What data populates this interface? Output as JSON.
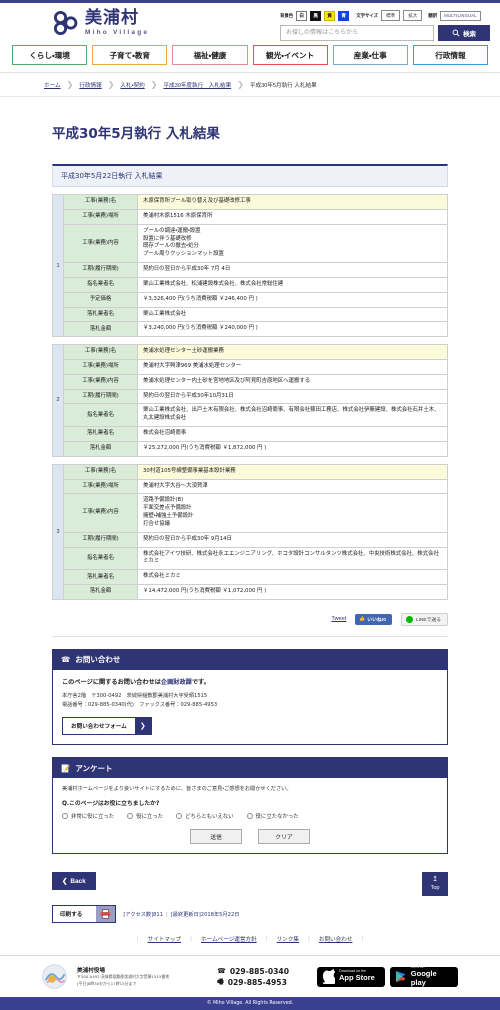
{
  "site": {
    "logo_jp": "美浦村",
    "logo_en": "Miho Village",
    "brand_color": "#2f3475"
  },
  "utility": {
    "bg_label": "背景色",
    "swatches": [
      {
        "name": "white",
        "label": "白"
      },
      {
        "name": "black",
        "label": "黒"
      },
      {
        "name": "yellow",
        "label": "黄"
      },
      {
        "name": "blue",
        "label": "青"
      }
    ],
    "fontsize_label": "文字サイズ",
    "fontsize_options": [
      "標準",
      "拡大"
    ],
    "translate_label": "翻訳",
    "multilingual": "MULTILINGUAL"
  },
  "search": {
    "placeholder": "お探しの情報はこちらから",
    "value": "",
    "button": "検索"
  },
  "gnav": [
    {
      "label": "くらし・環境",
      "color": "#57ab6a"
    },
    {
      "label": "子育て・教育",
      "color": "#e8a93a"
    },
    {
      "label": "福祉・健康",
      "color": "#e08d96"
    },
    {
      "label": "観光・イベント",
      "color": "#e8504a"
    },
    {
      "label": "産業・仕事",
      "color": "#7fa8c4"
    },
    {
      "label": "行政情報",
      "color": "#3e9ad6"
    }
  ],
  "breadcrumb": {
    "links": [
      "ホーム",
      "行政情報",
      "入札・契約",
      "平成30年度執行　入札結果"
    ],
    "current": "平成30年5月執行 入札結果"
  },
  "page": {
    "title": "平成30年5月執行 入札結果",
    "section_bar": "平成30年5月22日執行 入札結果"
  },
  "labels": {
    "name": "工事(業務)名",
    "place": "工事(業務)場所",
    "detail": "工事(業務)内容",
    "period": "工期(履行期間)",
    "nominated": "指名業者名",
    "planned_price": "予定価格",
    "winner": "落札業者名",
    "bid_amount": "落札金額"
  },
  "bids": [
    {
      "index": "1",
      "name": "木原保育所プール取り替え及び基礎改修工事",
      "place": "美浦村木原1516 木原保育所",
      "detail": "プールの調達・運搬・設置\n設置に伴う基礎改修\n既存プールの撤去・処分\nプール周りクッションマット設置",
      "period": "契約日の翌日から平成30年 7月 4日",
      "nominated": "栗山工業株式会社、松浦建設株式会社、株式会社常総住建",
      "planned_price": "￥3,326,400 円(うち消費税額 ￥246,400 円 )",
      "winner": "栗山工業株式会社",
      "bid_amount": "￥3,240,000 円(うち消費税額 ￥240,000 円 )"
    },
    {
      "index": "2",
      "name": "美浦水処理センター土砂運搬業務",
      "place": "美浦村大字興津969 美浦水処理センター",
      "detail": "美浦水処理センター内土砂を宮地地区及び阿見町吉原地区へ運搬する",
      "period": "契約日の翌日から平成30年10月31日",
      "nominated": "栗山工業株式会社、出戸土木有限会社、株式会社沼崎商事、有限会社篠田工務店、株式会社伊藤建設、株式会社石井土木、丸太建設株式会社",
      "winner": "株式会社沼崎商事",
      "bid_amount": "￥25,272,000 円(うち消費税額 ￥1,872,000 円 )"
    },
    {
      "index": "3",
      "name": "30村道105号線整備事業基本設計業務",
      "place": "美浦村大字大谷～大須賀津",
      "detail": "道路予備設計(B)\n平面交差点予備設計\n擁壁・補強土予備設計\n打合せ協議",
      "period": "契約日の翌日から平成30年 9月14日",
      "nominated": "株式会社アイワ技研、株式会社永エエンジニアリング、ホコタ設計コンサルタンツ株式会社、中央技術株式会社、株式会社ミカミ",
      "winner": "株式会社ミカミ",
      "bid_amount": "￥14,472,000 円(うち消費税額 ￥1,072,000 円 )"
    }
  ],
  "share": {
    "tweet": "Tweet",
    "facebook": "いいね!0",
    "line": "LINEで送る"
  },
  "inquiry": {
    "heading": "お問い合わせ",
    "lead_before": "このページに関するお問い合わせは",
    "lead_dept": "企画財政課",
    "lead_after": "です。",
    "address": "本庁舎2階　〒300-0492　茨城県稲敷郡美浦村大字受領1515",
    "contact": "電話番号：029-885-0340(代)　ファックス番号：029-885-4953",
    "form_button": "お問い合わせフォーム"
  },
  "enquete": {
    "heading": "アンケート",
    "lead": "美浦村ホームページをより良いサイトにするために、皆さまのご意見・ご感想をお聞かせください。",
    "question": "Q.このページはお役に立ちましたか?",
    "options": [
      "非常に役に立った",
      "役に立った",
      "どちらともいえない",
      "役に立たなかった"
    ],
    "submit": "送信",
    "clear": "クリア"
  },
  "bottom_nav": {
    "back": "Back",
    "top": "Top",
    "print": "印刷する",
    "access_label": "[アクセス数]",
    "access_count": "811",
    "updated_label": "[最終更新日]",
    "updated_date": "2018年5月22日"
  },
  "footer_links": [
    "サイトマップ",
    "ホームページ運営方針",
    "リンク集",
    "お問い合わせ"
  ],
  "footer": {
    "org": "美浦村役場",
    "address": "〒300-0492 茨城県稲敷郡美浦村大字受領1515番地",
    "hours": "[平日]8時30分から17時15分まで",
    "tel": "029-885-0340",
    "fax": "029-885-4953",
    "appstore_sub": "Download on the",
    "appstore_main": "App Store",
    "googleplay_sub": "Get it on",
    "googleplay_main": "Google play",
    "copyright": "© Miho Village. All Rights Reserved."
  }
}
